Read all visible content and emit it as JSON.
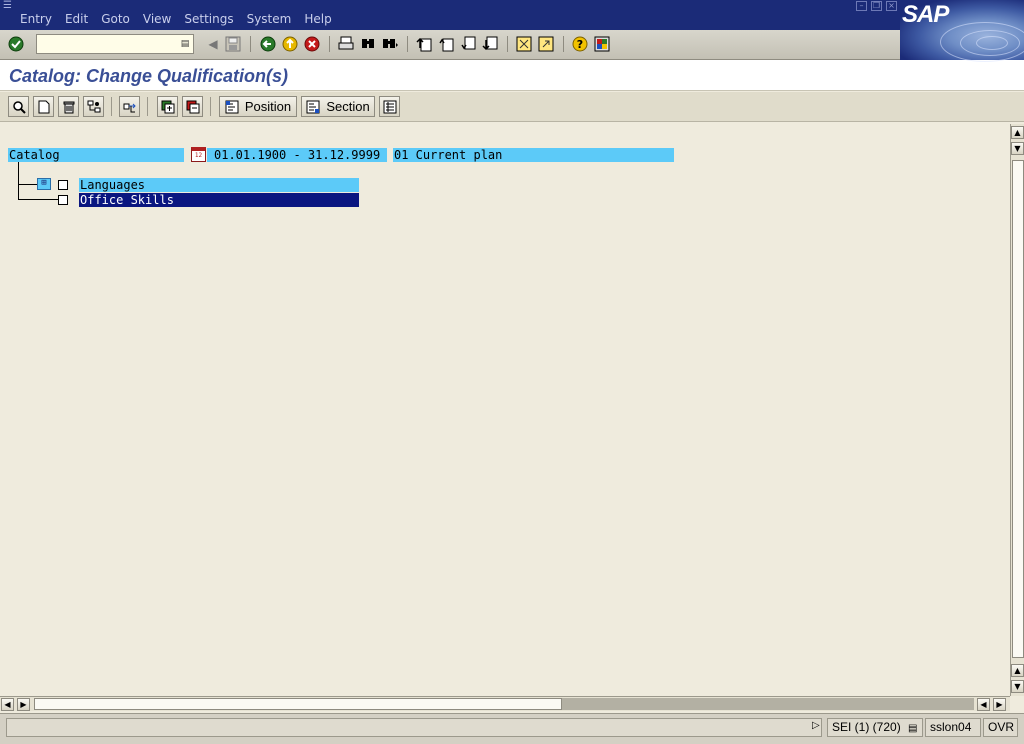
{
  "menu": {
    "items": [
      "Entry",
      "Edit",
      "Goto",
      "View",
      "Settings",
      "System",
      "Help"
    ]
  },
  "logo": {
    "text": "SAP"
  },
  "standard_toolbar": {
    "command_field": {
      "value": ""
    },
    "icons": [
      "enter-icon",
      "back-nav-icon",
      "save-icon",
      "back-icon",
      "exit-icon",
      "cancel-icon",
      "print-icon",
      "find-icon",
      "find-next-icon",
      "first-page-icon",
      "previous-page-icon",
      "next-page-icon",
      "last-page-icon",
      "new-session-icon",
      "shortcut-icon",
      "help-icon",
      "layout-icon"
    ]
  },
  "title": "Catalog: Change Qualification(s)",
  "app_toolbar": {
    "position_label": "Position",
    "section_label": "Section"
  },
  "catalog": {
    "label": "Catalog",
    "date_range": "01.01.1900 - 31.12.9999",
    "plan": "01 Current plan",
    "nodes": [
      {
        "label": "Languages",
        "selected": false
      },
      {
        "label": "Office Skills",
        "selected": true
      }
    ]
  },
  "status": {
    "system": "SEI (1) (720)",
    "server": "sslon04",
    "mode": "OVR"
  },
  "colors": {
    "menubar": "#1b2b78",
    "title_text": "#3a4f96",
    "field_highlight": "#5ccaf8",
    "selection": "#0a1680",
    "background": "#efebdd"
  }
}
